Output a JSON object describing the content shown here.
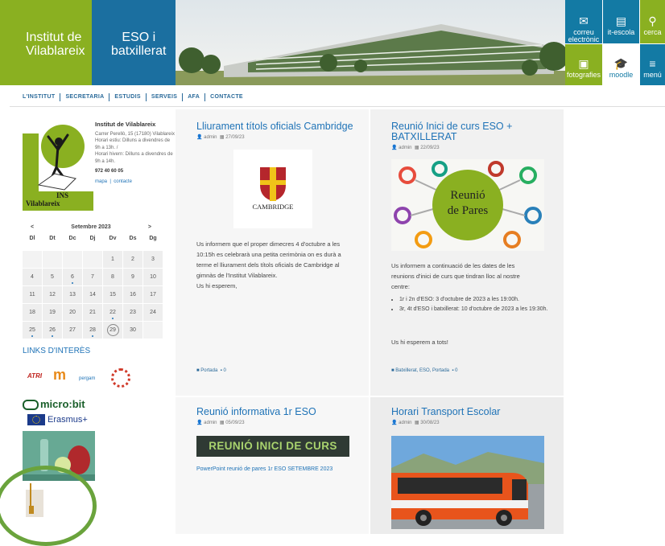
{
  "header": {
    "logo1": [
      "Institut de",
      "Vilablareix"
    ],
    "logo2": [
      "ESO i",
      "batxillerat"
    ],
    "tiles": [
      {
        "label": "correu electrònic",
        "icon": "mail-icon"
      },
      {
        "label": "it-escola",
        "icon": "book-icon"
      },
      {
        "label": "cerca",
        "icon": "search-icon"
      },
      {
        "label": "fotografies",
        "icon": "photo-icon"
      },
      {
        "label": "moodle",
        "icon": "moodle-icon"
      },
      {
        "label": "menú",
        "icon": "menu-icon"
      }
    ]
  },
  "nav": [
    "L'INSTITUT",
    "SECRETARIA",
    "ESTUDIS",
    "SERVEIS",
    "AFA",
    "CONTACTE"
  ],
  "school": {
    "name": "Institut de Vilablareix",
    "address": "Carrer Perellò, 15 (17180) Vilablareix",
    "hours_summer": "Horari estiu: Dilluns a divendres de 9h a 13h. /",
    "hours_winter": "Horari hivern: Dilluns a divendres de 9h a 14h.",
    "phone": "972 40 60 05",
    "map_link": "mapa",
    "contact_link": "contacte",
    "logo_text1": "INS",
    "logo_text2": "Vilablareix"
  },
  "calendar": {
    "month": "Setembre 2023",
    "prev": "<",
    "next": ">",
    "days": [
      "Dl",
      "Dt",
      "Dc",
      "Dj",
      "Dv",
      "Ds",
      "Dg"
    ],
    "weeks": [
      [
        "",
        "",
        "",
        "",
        "1",
        "2",
        "3"
      ],
      [
        "4",
        "5",
        "6",
        "7",
        "8",
        "9",
        "10"
      ],
      [
        "11",
        "12",
        "13",
        "14",
        "15",
        "16",
        "17"
      ],
      [
        "18",
        "19",
        "20",
        "21",
        "22",
        "23",
        "24"
      ],
      [
        "25",
        "26",
        "27",
        "28",
        "29",
        "30",
        ""
      ]
    ],
    "dots": [
      "6",
      "22",
      "25",
      "26",
      "28"
    ],
    "today": "29"
  },
  "links": {
    "title": "LINKS D'INTERÈS",
    "logos": [
      "ATRI",
      "m",
      "pergam"
    ],
    "microbit": "micro:bit",
    "erasmus": "Erasmus+"
  },
  "posts": [
    {
      "title": "Lliurament títols oficials Cambridge",
      "author": "admin",
      "date": "27/09/23",
      "image_text": "CAMBRIDGE",
      "body": "Us informem que el proper dimecres 4 d'octubre a les 10:15h es celebrarà una petita cerimònia on es durà a terme el lliurament dels títols oficials de Cambridge al gimnàs de l'Institut Vilablareix.",
      "body2": "Us hi esperem,",
      "footer": "Portada",
      "comments": "0"
    },
    {
      "title": "Reunió Inici de curs ESO + BATXILLERAT",
      "author": "admin",
      "date": "22/09/23",
      "image_text1": "Reunió",
      "image_text2": "de Pares",
      "body": "Us informem a continuació de les dates de les reunions d'inici de curs que tindran lloc al nostre centre:",
      "bullets": [
        "1r i 2n d'ESO: 3 d'octubre de 2023 a les 19:00h.",
        "3r, 4t d'ESO i batxillerat: 10 d'octubre de 2023 a les 19:30h."
      ],
      "body2": "Us hi esperem a tots!",
      "footer": "Batxillerat, ESO, Portada",
      "comments": "0"
    },
    {
      "title": "Reunió informativa 1r ESO",
      "author": "admin",
      "date": "05/09/23",
      "image_text": "REUNIÓ INICI DE CURS",
      "body": "PowerPoint reunió de pares 1r ESO SETEMBRE 2023"
    },
    {
      "title": "Horari Transport Escolar",
      "author": "admin",
      "date": "30/08/23"
    }
  ],
  "colors": {
    "green": "#8ab021",
    "blue": "#1b6fa0",
    "teal": "#137aa4",
    "link": "#1f73b7"
  }
}
